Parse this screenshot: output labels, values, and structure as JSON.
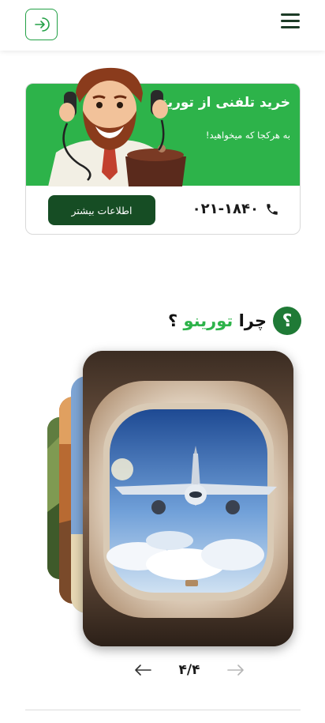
{
  "header": {
    "login_icon": "login-arrow-icon",
    "menu_icon": "hamburger-menu-icon",
    "accent": "#23a046"
  },
  "promo": {
    "title": "خرید تلفنی از تورینو",
    "subtitle": "به هرکجا که میخواهید!",
    "phone": "۰۲۱-۱۸۴۰",
    "phone_icon": "phone-icon",
    "more_button": "اطلاعات بیشتر",
    "bg_color": "#2db34a",
    "button_color": "#164d24"
  },
  "why": {
    "badge": "؟",
    "title_prefix": "چرا",
    "brand": "تورینو",
    "title_suffix": "؟"
  },
  "slider": {
    "page_indicator": "۴/۴",
    "prev_icon": "arrow-left-icon",
    "next_icon": "arrow-right-icon"
  }
}
